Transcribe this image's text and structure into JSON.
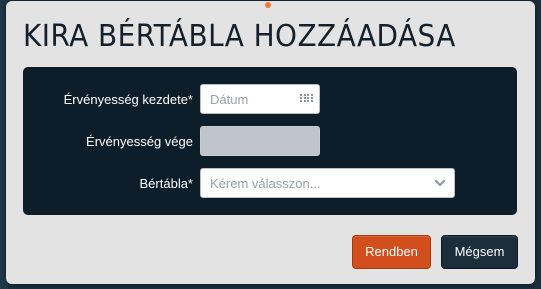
{
  "dialog": {
    "title": "KIRA BÉRTÁBLA HOZZÁADÁSA",
    "fields": [
      {
        "label": "Érvényesség kezdete*",
        "placeholder": "Dátum",
        "icon": "calendar-icon"
      },
      {
        "label": "Érvényesség vége",
        "placeholder": "",
        "disabled": true
      },
      {
        "label": "Bértábla*",
        "placeholder": "Kérem válasszon...",
        "icon": "chevron-down-icon"
      }
    ],
    "buttons": {
      "ok_label": "Rendben",
      "cancel_label": "Mégsem"
    }
  },
  "colors": {
    "accent": "#d24e1c",
    "panel": "#0d1d29",
    "dialog_bg": "#e3e3e3",
    "secondary_button": "#1c2e3b"
  }
}
